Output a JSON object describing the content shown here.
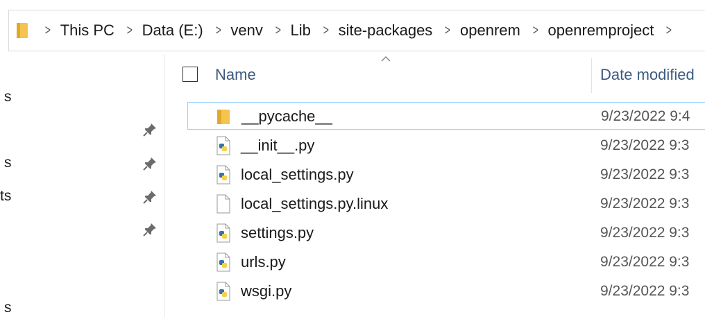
{
  "breadcrumb": {
    "icon": "folder-icon",
    "items": [
      "This PC",
      "Data (E:)",
      "venv",
      "Lib",
      "site-packages",
      "openrem",
      "openremproject"
    ],
    "separator": ">"
  },
  "navpane": {
    "items": [
      {
        "label": "s",
        "pinned": false
      },
      {
        "label": "",
        "pinned": true
      },
      {
        "label": "s",
        "pinned": true
      },
      {
        "label": "ts",
        "pinned": true
      },
      {
        "label": "",
        "pinned": true
      },
      {
        "label": "s",
        "pinned": false
      }
    ]
  },
  "columns": {
    "name": "Name",
    "date_modified": "Date modified"
  },
  "files": [
    {
      "name": "__pycache__",
      "date": "9/23/2022 9:4",
      "icon": "folder-icon",
      "selected": true
    },
    {
      "name": "__init__.py",
      "date": "9/23/2022 9:3",
      "icon": "python-file-icon",
      "selected": false
    },
    {
      "name": "local_settings.py",
      "date": "9/23/2022 9:3",
      "icon": "python-file-icon",
      "selected": false
    },
    {
      "name": "local_settings.py.linux",
      "date": "9/23/2022 9:3",
      "icon": "blank-file-icon",
      "selected": false
    },
    {
      "name": "settings.py",
      "date": "9/23/2022 9:3",
      "icon": "python-file-icon",
      "selected": false
    },
    {
      "name": "urls.py",
      "date": "9/23/2022 9:3",
      "icon": "python-file-icon",
      "selected": false
    },
    {
      "name": "wsgi.py",
      "date": "9/23/2022 9:3",
      "icon": "python-file-icon",
      "selected": false
    }
  ],
  "colors": {
    "folder": "#f4c44e",
    "selection_border": "#99d1ff",
    "header_text": "#3d5a80"
  }
}
